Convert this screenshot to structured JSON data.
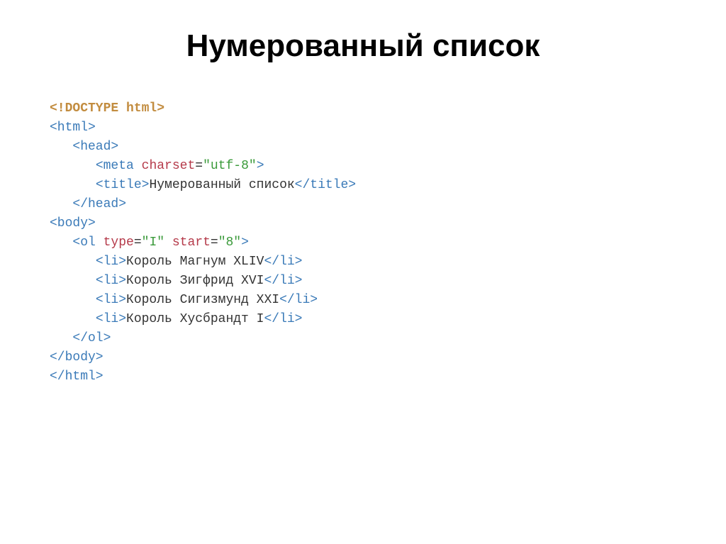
{
  "title": "Нумерованный список",
  "code": {
    "doctype": "<!DOCTYPE html>",
    "html_open": "<html>",
    "head_open": "<head>",
    "meta_open": "<meta",
    "charset_attr": "charset",
    "charset_val": "\"utf-8\"",
    "meta_close": ">",
    "title_open": "<title>",
    "title_text": "Нумерованный список",
    "title_close": "</title>",
    "head_close": "</head>",
    "body_open": "<body>",
    "ol_open": "<ol",
    "type_attr": "type",
    "type_val": "\"I\"",
    "start_attr": "start",
    "start_val": "\"8\"",
    "ol_open_end": ">",
    "li_open": "<li>",
    "li_close": "</li>",
    "li1": "Король Магнум XLIV",
    "li2": "Король Зигфрид XVI",
    "li3": "Король Сигизмунд XXI",
    "li4": "Король Хусбрандт I",
    "ol_close": "</ol>",
    "body_close": "</body>",
    "html_close": "</html>"
  }
}
